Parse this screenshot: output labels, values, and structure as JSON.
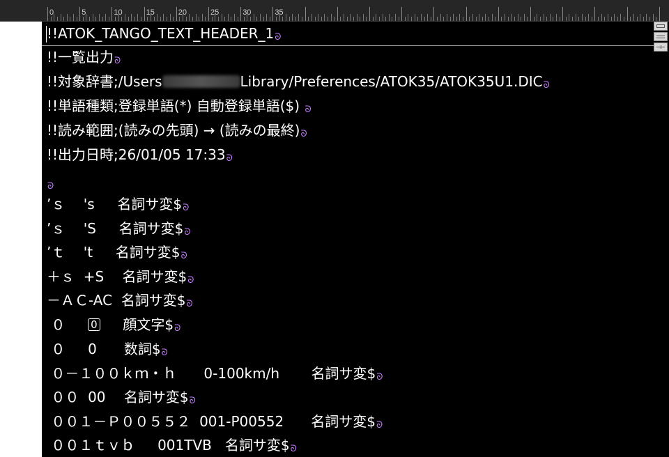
{
  "ruler": {
    "labels": [
      "0",
      "5",
      "10",
      "15",
      "20",
      "25",
      "30",
      "35"
    ]
  },
  "editor": {
    "lines": [
      {
        "text": "!!ATOK_TANGO_TEXT_HEADER_1"
      },
      {
        "text": "!!一覧出力"
      },
      {
        "text_before": "!!対象辞書;/Users",
        "text_after": "Library/Preferences/ATOK35/ATOK35U1.DIC"
      },
      {
        "text": "!!単語種類;登録単語(*) 自動登録単語($) "
      },
      {
        "text": "!!読み範囲;(読みの先頭) → (読みの最終)"
      },
      {
        "text": "!!出力日時;26/01/05 17:33"
      },
      {
        "text": ""
      },
      {
        "text": "’ｓ　 's　  名詞サ変$"
      },
      {
        "text": "’ｓ　 'S　  名詞サ変$"
      },
      {
        "text": "’ｔ　 't　  名詞サ変$"
      },
      {
        "text": "＋ｓ  +S　 名詞サ変$"
      },
      {
        "text": "－ＡＣ-AC  名詞サ変$"
      },
      {
        "text_before": " ０　  ",
        "boxed": "0",
        "text_after": "　  顔文字$"
      },
      {
        "text": " ０　  0　   数詞$"
      },
      {
        "text": " ０－１００ｋｍ・ｈ　   0-100km/h　    名詞サ変$"
      },
      {
        "text": " ００  00　 名詞サ変$"
      },
      {
        "text": " ００１－Ｐ００５５２  001-P00552　   名詞サ変$"
      },
      {
        "text": " ００１ｔｖｂ　  001TVB   名詞サ変$"
      }
    ]
  },
  "colors": {
    "background": "#000000",
    "text": "#ffffff",
    "return_mark": "#c77dff",
    "gutter": "#ffffff"
  }
}
